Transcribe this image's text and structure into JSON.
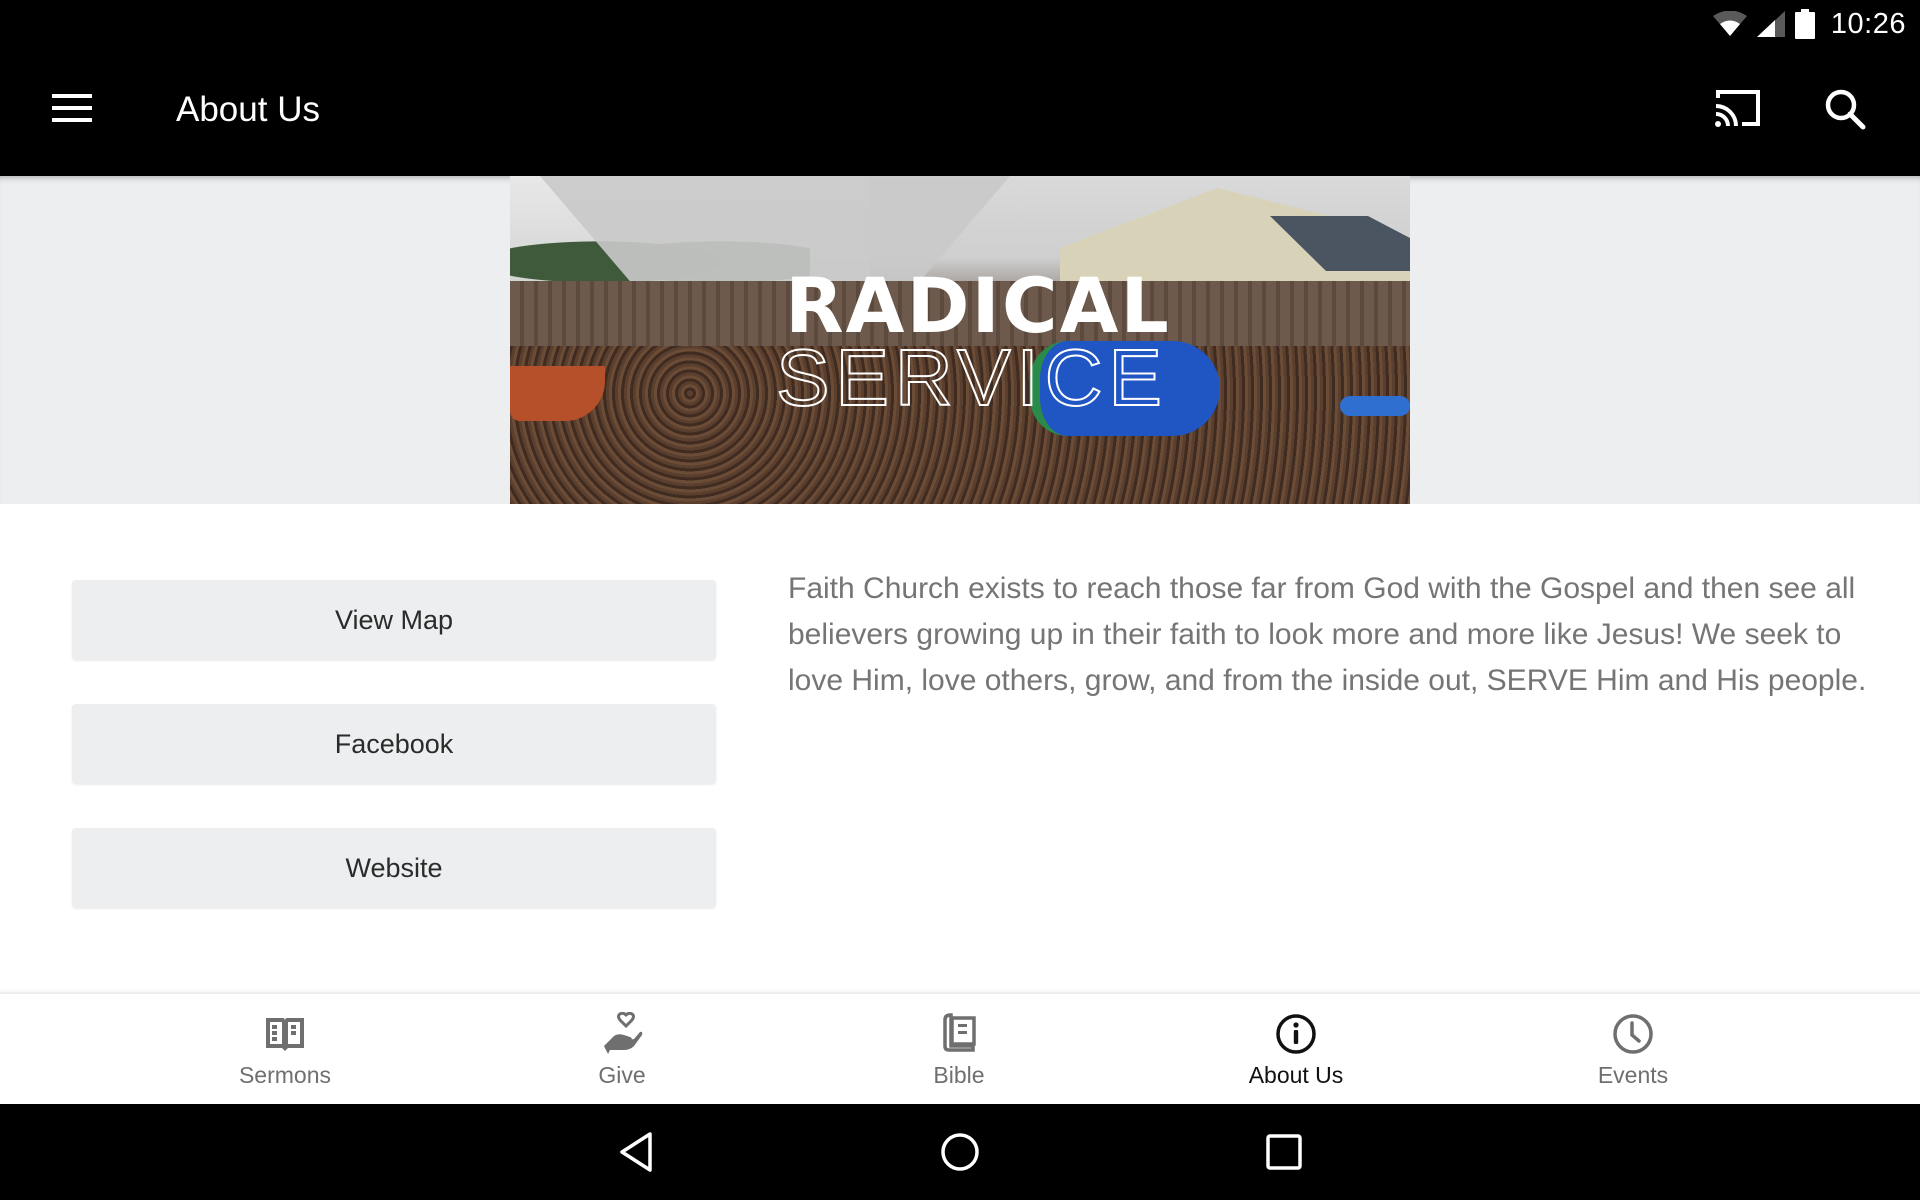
{
  "status_bar": {
    "time": "10:26",
    "icons": [
      "wifi-icon",
      "cell-signal-icon",
      "battery-icon"
    ]
  },
  "app_bar": {
    "title": "About Us",
    "icons": {
      "menu": "hamburger-menu-icon",
      "cast": "cast-icon",
      "search": "search-icon"
    }
  },
  "hero": {
    "title_line1": "RADICAL",
    "title_line2": "SERVICE"
  },
  "buttons": {
    "view_map": "View Map",
    "facebook": "Facebook",
    "website": "Website"
  },
  "about": {
    "text": "Faith Church exists to reach those far from God with the Gospel and then see all believers growing up in their faith to look more and more like Jesus! We seek to love Him, love others, grow, and from the inside out, SERVE Him and His people."
  },
  "bottom_nav": {
    "active": "About Us",
    "items": [
      {
        "label": "Sermons",
        "icon": "open-book-icon"
      },
      {
        "label": "Give",
        "icon": "hand-heart-icon"
      },
      {
        "label": "Bible",
        "icon": "bible-icon"
      },
      {
        "label": "About Us",
        "icon": "info-icon"
      },
      {
        "label": "Events",
        "icon": "clock-icon"
      }
    ]
  },
  "colors": {
    "app_bar_bg": "#000000",
    "hero_bg": "#eceeef",
    "button_bg": "#eceeef",
    "body_text": "#757575",
    "nav_inactive": "#6f6f6f",
    "nav_active": "#111111"
  },
  "system_nav": {
    "icons": [
      "back-icon",
      "home-icon",
      "recents-icon"
    ]
  }
}
